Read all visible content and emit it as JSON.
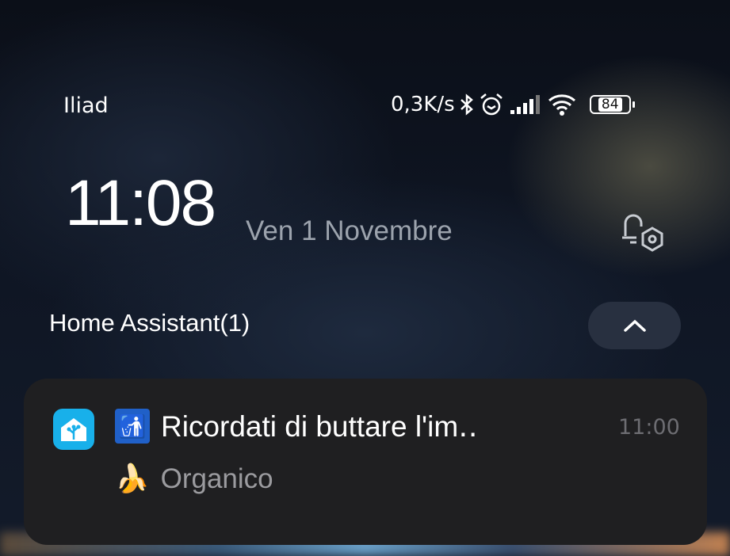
{
  "status_bar": {
    "carrier": "Iliad",
    "network_speed": "0,3K/s",
    "icons": [
      "bluetooth-icon",
      "alarm-icon",
      "signal-icon",
      "wifi-icon"
    ],
    "battery": "84"
  },
  "lockscreen": {
    "time": "11:08",
    "date": "Ven 1 Novembre"
  },
  "notification_group": {
    "title": "Home Assistant(1)"
  },
  "notification": {
    "app_icon": "home-assistant-icon",
    "title_emoji": "🚮",
    "title": "Ricordati di buttare l'im‥",
    "time": "11:00",
    "body_emoji": "🍌",
    "body": "Organico"
  },
  "colors": {
    "card": "#1f1f21",
    "app_icon": "#18b0ea"
  }
}
